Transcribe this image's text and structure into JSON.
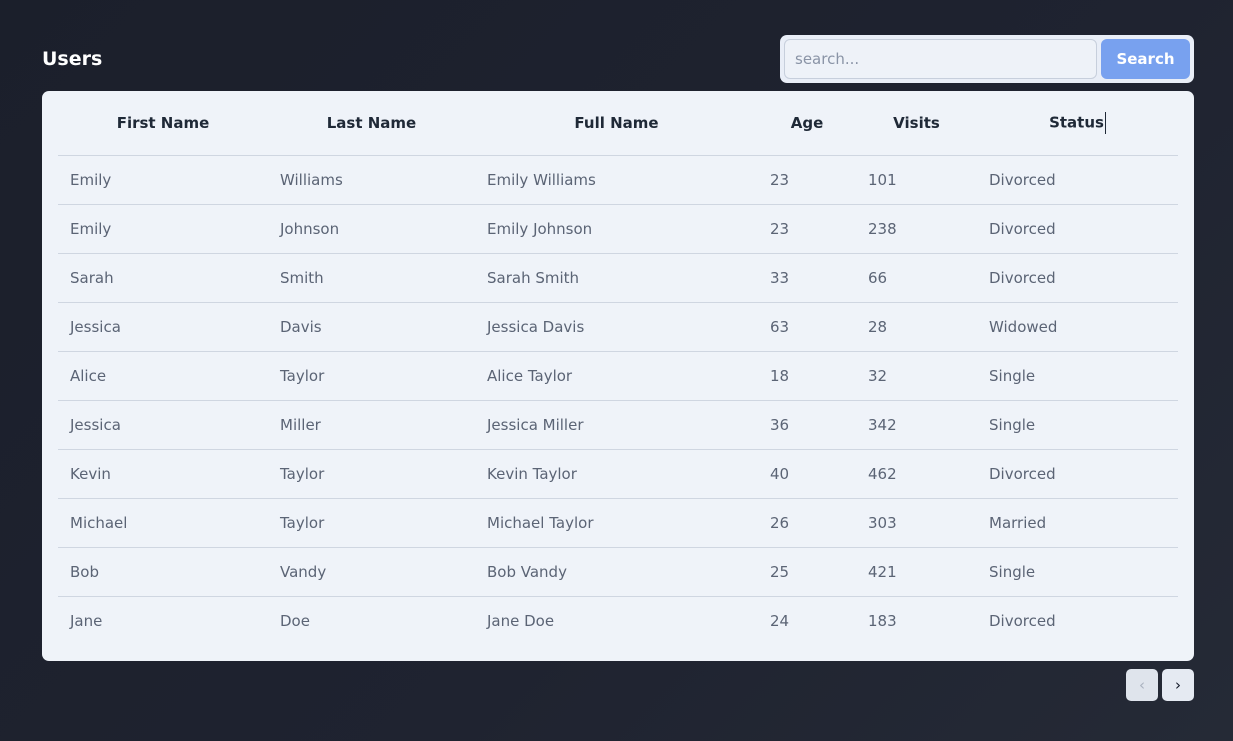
{
  "header": {
    "title": "Users"
  },
  "search": {
    "placeholder": "search...",
    "value": "",
    "button_label": "Search"
  },
  "table": {
    "columns": [
      "First Name",
      "Last Name",
      "Full Name",
      "Age",
      "Visits",
      "Status"
    ],
    "rows": [
      [
        "Emily",
        "Williams",
        "Emily Williams",
        "23",
        "101",
        "Divorced"
      ],
      [
        "Emily",
        "Johnson",
        "Emily Johnson",
        "23",
        "238",
        "Divorced"
      ],
      [
        "Sarah",
        "Smith",
        "Sarah Smith",
        "33",
        "66",
        "Divorced"
      ],
      [
        "Jessica",
        "Davis",
        "Jessica Davis",
        "63",
        "28",
        "Widowed"
      ],
      [
        "Alice",
        "Taylor",
        "Alice Taylor",
        "18",
        "32",
        "Single"
      ],
      [
        "Jessica",
        "Miller",
        "Jessica Miller",
        "36",
        "342",
        "Single"
      ],
      [
        "Kevin",
        "Taylor",
        "Kevin Taylor",
        "40",
        "462",
        "Divorced"
      ],
      [
        "Michael",
        "Taylor",
        "Michael Taylor",
        "26",
        "303",
        "Married"
      ],
      [
        "Bob",
        "Vandy",
        "Bob Vandy",
        "25",
        "421",
        "Single"
      ],
      [
        "Jane",
        "Doe",
        "Jane Doe",
        "24",
        "183",
        "Divorced"
      ]
    ]
  },
  "pagination": {
    "prev_icon": "‹",
    "next_icon": "›",
    "prev_disabled": true
  },
  "colors": {
    "background": "#1e2230",
    "card": "#eff3f9",
    "accent": "#78a1ef"
  }
}
